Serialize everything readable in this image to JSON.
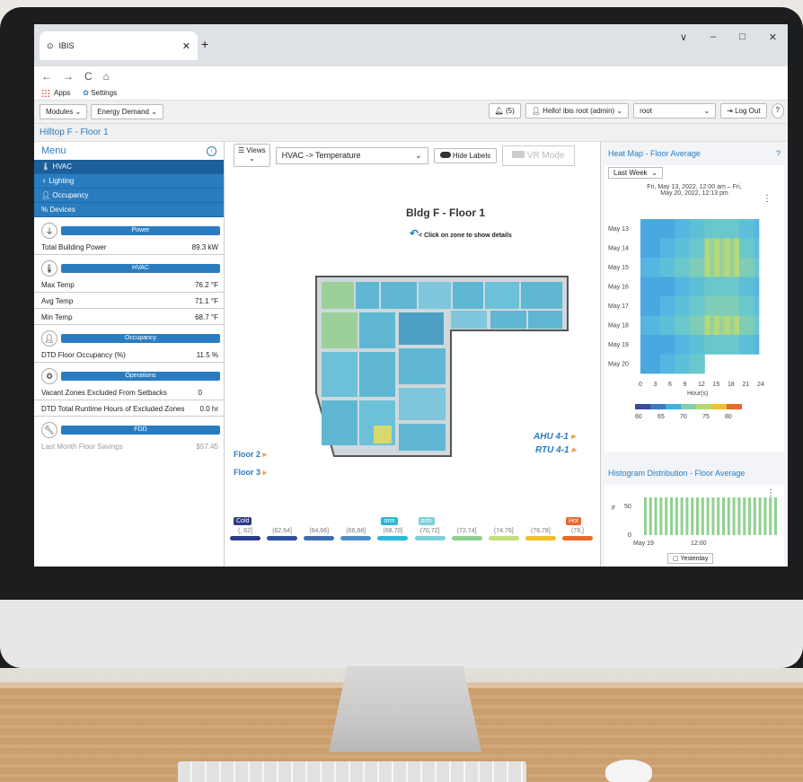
{
  "browser": {
    "tab_title": "IBIS",
    "new_tab": "+",
    "window_controls": [
      "∨",
      "–",
      "□",
      "✕"
    ],
    "nav_icons": [
      "←",
      "→",
      "C",
      "⌂"
    ],
    "bookmarks": [
      {
        "label": "Apps"
      },
      {
        "label": "Settings"
      }
    ]
  },
  "toolbar": {
    "modules": "Modules",
    "energy_demand": "Energy Demand",
    "notifications": "(5)",
    "user": "Hello! ibis root (admin)",
    "root_select": "root",
    "logout": "Log Out",
    "help": "?"
  },
  "breadcrumb": "Hilltop F - Floor 1",
  "menu": {
    "title": "Menu",
    "items": [
      {
        "label": "HVAC",
        "icon": "thermometer-icon"
      },
      {
        "label": "Lighting",
        "icon": "bulb-icon"
      },
      {
        "label": "Occupancy",
        "icon": "person-icon"
      },
      {
        "label": "Devices",
        "icon": "link-icon"
      }
    ],
    "groups": {
      "power": {
        "title": "Power",
        "rows": [
          {
            "label": "Total Building Power",
            "value": "89.3 kW"
          }
        ]
      },
      "hvac": {
        "title": "HVAC",
        "rows": [
          {
            "label": "Max Temp",
            "value": "76.2 °F"
          },
          {
            "label": "Avg Temp",
            "value": "71.1 °F"
          },
          {
            "label": "Min Temp",
            "value": "68.7 °F"
          }
        ]
      },
      "occupancy": {
        "title": "Occupancy",
        "rows": [
          {
            "label": "DTD Floor Occupancy (%)",
            "value": "11.5 %"
          }
        ]
      },
      "operations": {
        "title": "Operations",
        "rows": [
          {
            "label": "Vacant Zones Excluded From Setbacks",
            "value": "0"
          },
          {
            "label": "DTD Total Runtime Hours of Excluded Zones",
            "value": "0.0 hr"
          }
        ]
      },
      "fdd": {
        "title": "FDD",
        "rows": [
          {
            "label": "Last Month Floor Savings",
            "value": "$57.45"
          }
        ]
      }
    }
  },
  "center": {
    "views": "Views",
    "mode_select": "HVAC -> Temperature",
    "hide_labels": "Hide Labels",
    "vr_mode": "VR Mode",
    "title": "Bldg F - Floor 1",
    "hint": "< Click on zone to show details",
    "floors": [
      "Floor 2",
      "Floor 3"
    ],
    "units": [
      "AHU 4-1",
      "RTU 4-1"
    ],
    "legend": [
      {
        "range": "(, 62]",
        "color": "#2b3a8a",
        "tag": "Cold"
      },
      {
        "range": "(62,64]",
        "color": "#2f4f9e",
        "tag": ""
      },
      {
        "range": "(64,66]",
        "color": "#3d6fb0",
        "tag": ""
      },
      {
        "range": "(66,68]",
        "color": "#4f8ec4",
        "tag": ""
      },
      {
        "range": "(68,70]",
        "color": "#2cb7d9",
        "tag": "orm"
      },
      {
        "range": "(70,72]",
        "color": "#7fd0d8",
        "tag": "orm"
      },
      {
        "range": "(72,74]",
        "color": "#8fcf8f",
        "tag": ""
      },
      {
        "range": "(74,76]",
        "color": "#c3de7a",
        "tag": ""
      },
      {
        "range": "(76,78]",
        "color": "#f2c029",
        "tag": ""
      },
      {
        "range": "(78,]",
        "color": "#e8692a",
        "tag": "Hot"
      }
    ]
  },
  "heatmap": {
    "title": "Heat Map - Floor Average",
    "period": "Last Week",
    "range_line1": "Fri, May 13, 2022, 12:00 am – Fri,",
    "range_line2": "May 20, 2022, 12:13 pm",
    "days": [
      "May 13",
      "May 14",
      "May 15",
      "May 16",
      "May 17",
      "May 18",
      "May 19",
      "May 20"
    ],
    "hours": [
      "0",
      "3",
      "6",
      "9",
      "12",
      "15",
      "18",
      "21",
      "24"
    ],
    "xlabel": "Hour(s)",
    "scale": [
      "60",
      "65",
      "70",
      "75",
      "80"
    ]
  },
  "histogram": {
    "title": "Histogram Distribution - Floor Average",
    "yticks": [
      "50",
      "0"
    ],
    "yaxis_label": "F",
    "xticks": [
      "May 19",
      "12:00"
    ],
    "button": "Yesterday"
  }
}
